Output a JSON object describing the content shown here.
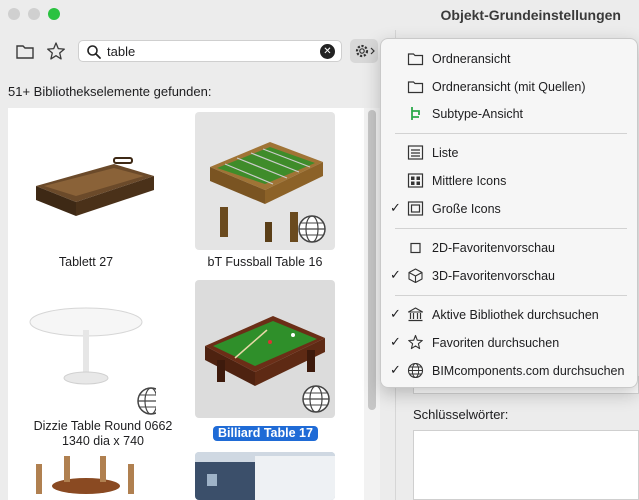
{
  "window": {
    "title": "Objekt-Grundeinstellungen"
  },
  "search": {
    "value": "table",
    "placeholder": ""
  },
  "results": {
    "count_text": "51+ Bibliothekselemente gefunden:",
    "items": [
      {
        "label": "Tablett 27"
      },
      {
        "label": "bT Fussball Table 16"
      },
      {
        "label": "Dizzie Table Round 0662\n1340 dia x 740"
      },
      {
        "label": "Billiard Table 17"
      }
    ]
  },
  "menu": {
    "items": [
      {
        "label": "Ordneransicht",
        "checked": false,
        "icon": "folder-icon"
      },
      {
        "label": "Ordneransicht (mit Quellen)",
        "checked": false,
        "icon": "folder-icon"
      },
      {
        "label": "Subtype-Ansicht",
        "checked": false,
        "icon": "subtype-icon"
      },
      {
        "label": "Liste",
        "checked": false,
        "icon": "list-icon"
      },
      {
        "label": "Mittlere Icons",
        "checked": false,
        "icon": "medium-icons-icon"
      },
      {
        "label": "Große Icons",
        "checked": true,
        "icon": "large-icons-icon"
      },
      {
        "label": "2D-Favoritenvorschau",
        "checked": false,
        "icon": "square-icon"
      },
      {
        "label": "3D-Favoritenvorschau",
        "checked": true,
        "icon": "cube-icon"
      },
      {
        "label": "Aktive Bibliothek durchsuchen",
        "checked": true,
        "icon": "library-icon"
      },
      {
        "label": "Favoriten durchsuchen",
        "checked": true,
        "icon": "star-icon"
      },
      {
        "label": "BIMcomponents.com durchsuchen",
        "checked": true,
        "icon": "globe-icon"
      }
    ],
    "check_glyph": "✓"
  },
  "right_panel": {
    "keywords_label": "Schlüsselwörter:"
  },
  "colors": {
    "selection": "#1f6bd6",
    "subtype_green": "#2ba84a"
  }
}
